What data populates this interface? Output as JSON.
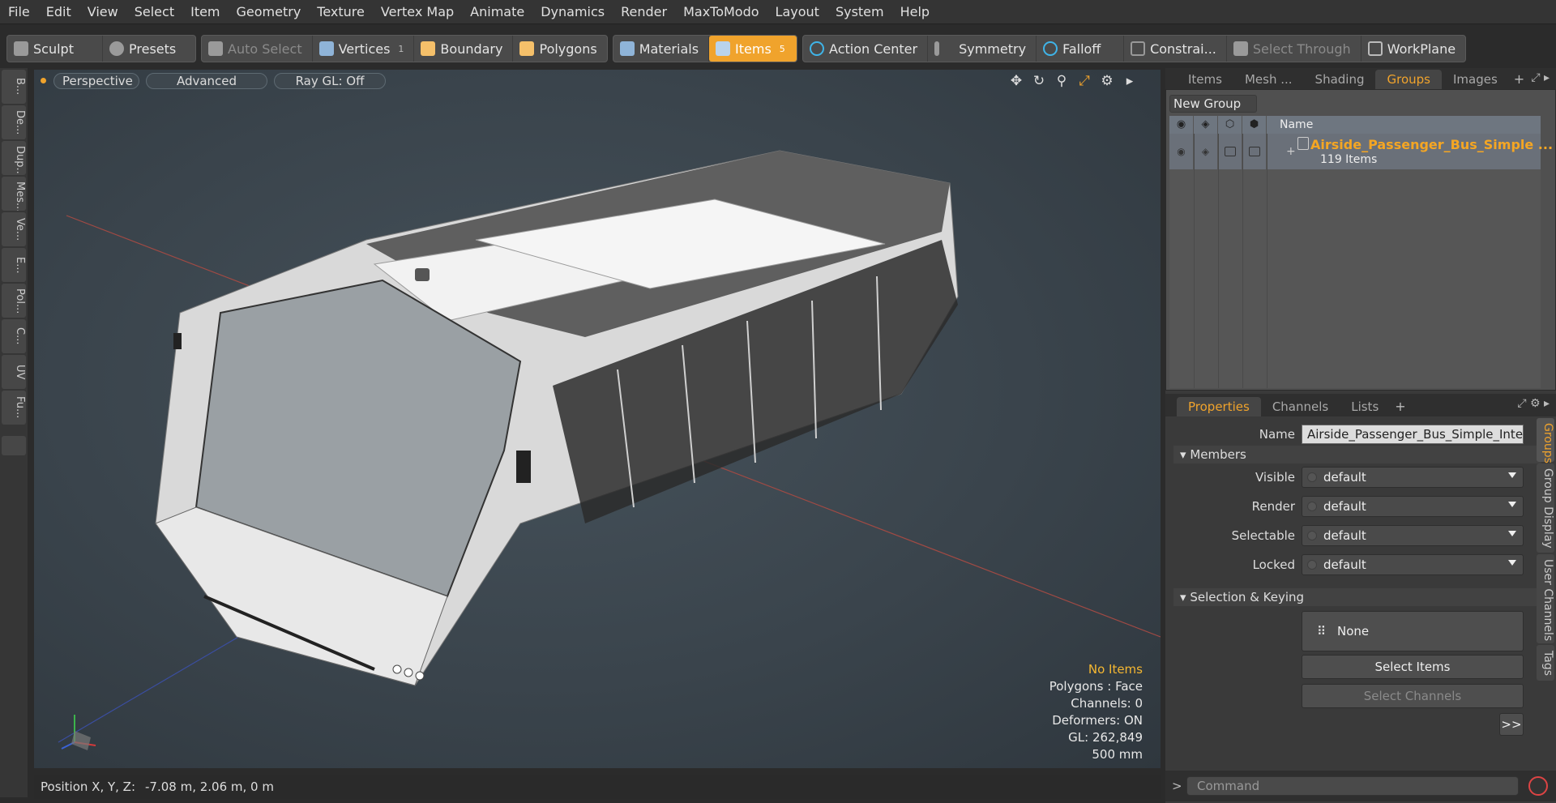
{
  "menubar": {
    "items": [
      "File",
      "Edit",
      "View",
      "Select",
      "Item",
      "Geometry",
      "Texture",
      "Vertex Map",
      "Animate",
      "Dynamics",
      "Render",
      "MaxToModo",
      "Layout",
      "System",
      "Help"
    ]
  },
  "toolbar": {
    "sculpt": "Sculpt",
    "presets": "Presets",
    "auto_select": "Auto Select",
    "vertices": "Vertices",
    "vertices_count": "1",
    "boundary": "Boundary",
    "polygons": "Polygons",
    "materials": "Materials",
    "items": "Items",
    "items_count": "5",
    "action_center": "Action Center",
    "symmetry": "Symmetry",
    "falloff": "Falloff",
    "constraints": "Constrai...",
    "select_through": "Select Through",
    "workplane": "WorkPlane"
  },
  "left_tabs": [
    "B...",
    "De...",
    "Dup...",
    "Mes...",
    "Ve...",
    "E...",
    "Pol...",
    "C...",
    "UV",
    "Fu..."
  ],
  "viewport": {
    "view": "Perspective",
    "shading": "Advanced",
    "raygl": "Ray GL: Off",
    "info": {
      "selection": "No Items",
      "polygons": "Polygons : Face",
      "channels": "Channels: 0",
      "deformers": "Deformers: ON",
      "gl": "GL: 262,849",
      "scale": "500 mm"
    }
  },
  "statusbar": {
    "position_label": "Position X, Y, Z:",
    "position_value": "-7.08 m, 2.06 m, 0 m"
  },
  "top_tabs": [
    "Items",
    "Mesh ...",
    "Shading",
    "Groups",
    "Images"
  ],
  "groups": {
    "new_group": "New Group",
    "column_name": "Name",
    "row_name": "Airside_Passenger_Bus_Simple ...",
    "row_count": "119 Items"
  },
  "props_tabs": [
    "Properties",
    "Channels",
    "Lists"
  ],
  "properties": {
    "name_label": "Name",
    "name_value": "Airside_Passenger_Bus_Simple_Interic",
    "members_header": "Members",
    "visible_label": "Visible",
    "visible_value": "default",
    "render_label": "Render",
    "render_value": "default",
    "selectable_label": "Selectable",
    "selectable_value": "default",
    "locked_label": "Locked",
    "locked_value": "default",
    "selkey_header": "Selection & Keying",
    "none_label": "None",
    "select_items": "Select Items",
    "select_channels": "Select Channels",
    "more": ">>"
  },
  "side_tabs": [
    "Groups",
    "Group Display",
    "User Channels",
    "Tags"
  ],
  "command": {
    "placeholder": "Command"
  },
  "colors": {
    "accent": "#f0a32c",
    "selected_name": "#f5a623",
    "warning": "#f5b731"
  }
}
